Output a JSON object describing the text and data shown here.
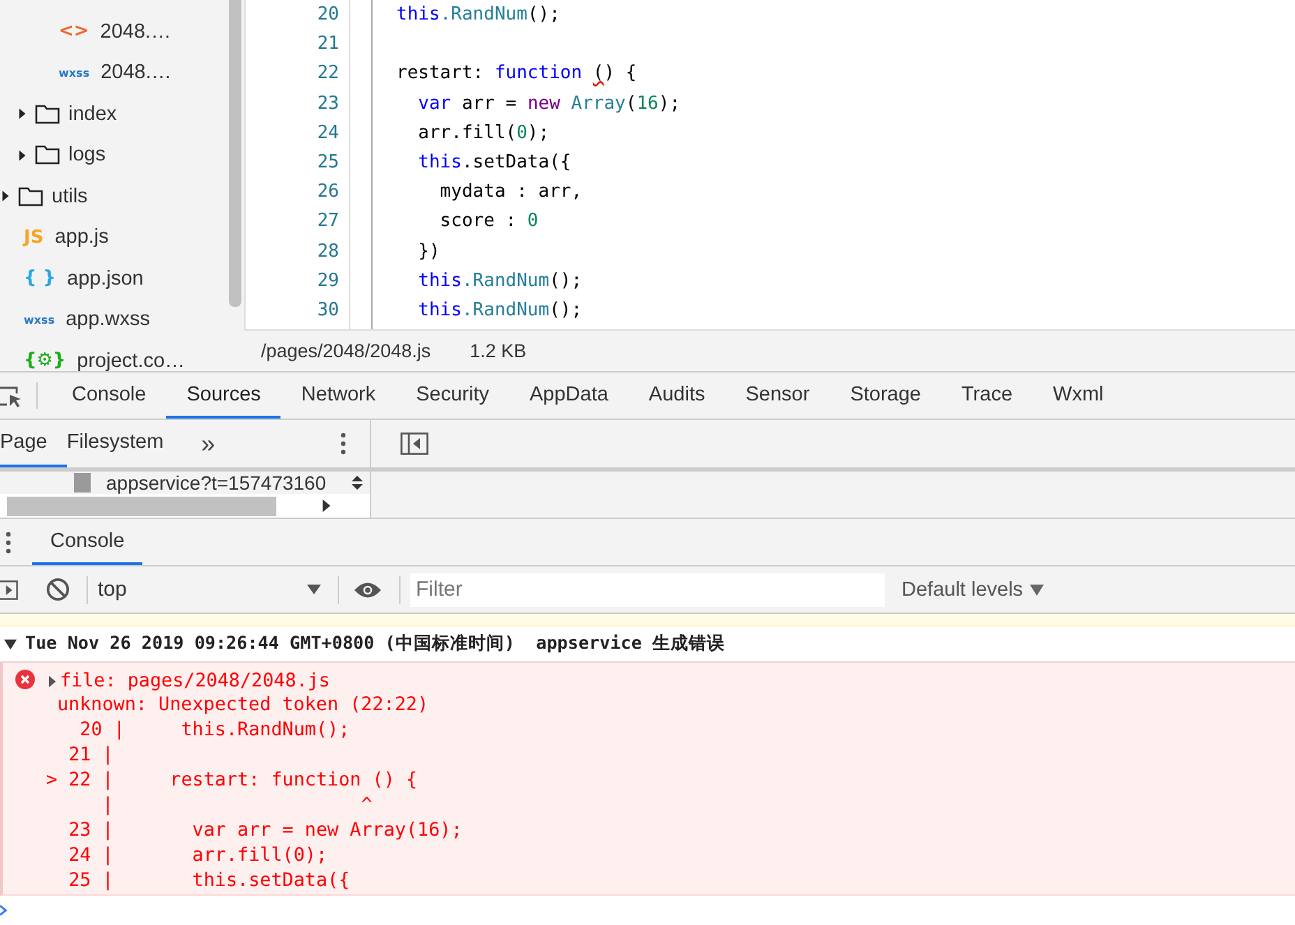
{
  "sidebar": {
    "tree": [
      {
        "kind": "group",
        "children": [
          {
            "kind": "group",
            "children": [
              {
                "kind": "file",
                "badge": "<>",
                "color": "#f0672a",
                "label": "2048.…"
              },
              {
                "kind": "file",
                "badge": "wxss",
                "color": "#2979c6",
                "label": "2048.…"
              }
            ]
          },
          {
            "kind": "folder",
            "label": "index",
            "expanded": false
          },
          {
            "kind": "folder",
            "label": "logs",
            "expanded": false
          }
        ]
      },
      {
        "kind": "folder",
        "label": "utils",
        "expanded": false
      },
      {
        "kind": "file",
        "badge": "JS",
        "color": "#f5a623",
        "label": "app.js"
      },
      {
        "kind": "file",
        "badge": "{ }",
        "color": "#27a8e0",
        "label": "app.json"
      },
      {
        "kind": "file",
        "badge": "wxss",
        "color": "#2979c6",
        "label": "app.wxss"
      },
      {
        "kind": "file",
        "badge": "{⚙}",
        "color": "#1aad19",
        "label": "project.co…"
      }
    ]
  },
  "editor": {
    "lines": [
      {
        "num": "20",
        "tokens": [
          {
            "t": "this",
            "kind": "keyword"
          },
          {
            "t": ".RandNum",
            "kind": "method"
          },
          {
            "t": "();",
            "kind": "plain"
          }
        ]
      },
      {
        "num": "21"
      },
      {
        "num": "22",
        "tokens": [
          {
            "t": "restart: ",
            "kind": "plain"
          },
          {
            "t": "function ",
            "kind": "keyword"
          },
          {
            "t": "(",
            "kind": "plain",
            "error": true
          },
          {
            "t": ") {",
            "kind": "plain"
          }
        ]
      },
      {
        "num": "23",
        "tokens": [
          {
            "t": "  var",
            "kind": "keyword"
          },
          {
            "t": " arr = ",
            "kind": "plain"
          },
          {
            "t": "new ",
            "kind": "operator"
          },
          {
            "t": "Array",
            "kind": "method"
          },
          {
            "t": "(",
            "kind": "plain"
          },
          {
            "t": "16",
            "kind": "number"
          },
          {
            "t": ");",
            "kind": "plain"
          }
        ]
      },
      {
        "num": "24",
        "tokens": [
          {
            "t": "  arr.fill(",
            "kind": "plain"
          },
          {
            "t": "0",
            "kind": "number"
          },
          {
            "t": ");",
            "kind": "plain"
          }
        ]
      },
      {
        "num": "25",
        "tokens": [
          {
            "t": "  this",
            "kind": "keyword"
          },
          {
            "t": ".setData({",
            "kind": "plain"
          }
        ]
      },
      {
        "num": "26",
        "tokens": [
          {
            "t": "    mydata : arr,",
            "kind": "plain"
          }
        ]
      },
      {
        "num": "27",
        "tokens": [
          {
            "t": "    score : ",
            "kind": "plain"
          },
          {
            "t": "0",
            "kind": "number"
          }
        ]
      },
      {
        "num": "28",
        "tokens": [
          {
            "t": "  })",
            "kind": "plain"
          }
        ]
      },
      {
        "num": "29",
        "tokens": [
          {
            "t": "  this",
            "kind": "keyword"
          },
          {
            "t": ".RandNum",
            "kind": "method"
          },
          {
            "t": "();",
            "kind": "plain"
          }
        ]
      },
      {
        "num": "30",
        "tokens": [
          {
            "t": "  this",
            "kind": "keyword"
          },
          {
            "t": ".RandNum",
            "kind": "method"
          },
          {
            "t": "();",
            "kind": "plain"
          }
        ]
      }
    ],
    "status_bar": {
      "path": "/pages/2048/2048.js",
      "size": "1.2 KB"
    }
  },
  "devtools": {
    "tabs": [
      {
        "label": "Console",
        "selected": false
      },
      {
        "label": "Sources",
        "selected": true
      },
      {
        "label": "Network",
        "selected": false
      },
      {
        "label": "Security",
        "selected": false
      },
      {
        "label": "AppData",
        "selected": false
      },
      {
        "label": "Audits",
        "selected": false
      },
      {
        "label": "Sensor",
        "selected": false
      },
      {
        "label": "Storage",
        "selected": false
      },
      {
        "label": "Trace",
        "selected": false
      },
      {
        "label": "Wxml",
        "selected": false
      }
    ],
    "navigator_tabs": [
      {
        "label": "Page",
        "selected": true
      },
      {
        "label": "Filesystem",
        "selected": false
      }
    ],
    "more_tabs": "»",
    "navigator_item": "appservice?t=157473160"
  },
  "drawer": {
    "tabs": [
      {
        "label": "Console",
        "selected": true
      }
    ]
  },
  "console": {
    "context": "top",
    "filter": {
      "placeholder": "Filter"
    },
    "levels": "Default levels",
    "group": {
      "expanded": true,
      "header": "Tue Nov 26 2019 09:26:44 GMT+0800 (中国标准时间)  appservice 生成错误"
    },
    "messages": [
      {
        "kind": "error",
        "expanded": false,
        "title": "file: pages/2048/2048.js",
        "lines": [
          "unknown: Unexpected token (22:22)",
          "   20 |     this.RandNum();",
          "  21 |",
          "> 22 |     restart: function () {",
          "     |                      ^",
          "  23 |       var arr = new Array(16);",
          "  24 |       arr.fill(0);",
          "  25 |       this.setData({"
        ]
      }
    ]
  }
}
